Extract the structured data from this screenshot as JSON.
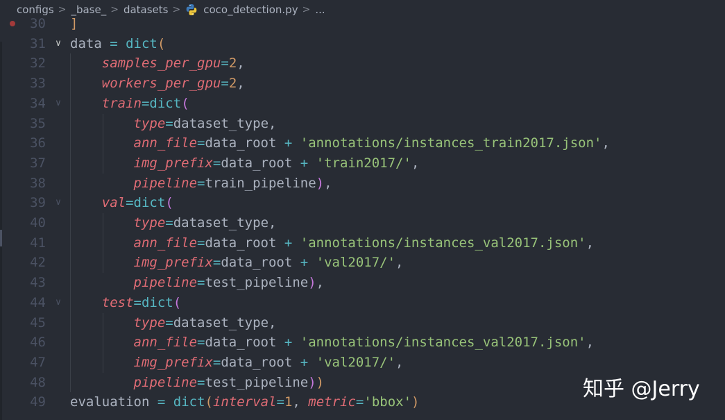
{
  "breadcrumb": {
    "items": [
      "configs",
      "_base_",
      "datasets",
      "coco_detection.py",
      "..."
    ],
    "separator": ">",
    "file_icon": "python-icon"
  },
  "editor": {
    "lines": [
      {
        "num": "30",
        "fold": "",
        "tokens": [
          {
            "t": "]",
            "c": "bracket-close"
          }
        ]
      },
      {
        "num": "31",
        "fold": "v",
        "tokens": [
          {
            "t": "data ",
            "c": "kw-var"
          },
          {
            "t": "=",
            "c": "op"
          },
          {
            "t": " ",
            "c": "kw-var"
          },
          {
            "t": "dict",
            "c": "fn"
          },
          {
            "t": "(",
            "c": "paren2"
          }
        ]
      },
      {
        "num": "32",
        "fold": "",
        "tokens": [
          {
            "t": "    ",
            "c": "kw-var"
          },
          {
            "t": "samples_per_gpu",
            "c": "param"
          },
          {
            "t": "=",
            "c": "op"
          },
          {
            "t": "2",
            "c": "num"
          },
          {
            "t": ",",
            "c": "kw-var"
          }
        ]
      },
      {
        "num": "33",
        "fold": "",
        "tokens": [
          {
            "t": "    ",
            "c": "kw-var"
          },
          {
            "t": "workers_per_gpu",
            "c": "param"
          },
          {
            "t": "=",
            "c": "op"
          },
          {
            "t": "2",
            "c": "num"
          },
          {
            "t": ",",
            "c": "kw-var"
          }
        ]
      },
      {
        "num": "34",
        "fold": "v",
        "tokens": [
          {
            "t": "    ",
            "c": "kw-var"
          },
          {
            "t": "train",
            "c": "param"
          },
          {
            "t": "=",
            "c": "op"
          },
          {
            "t": "dict",
            "c": "fn"
          },
          {
            "t": "(",
            "c": "paren"
          }
        ]
      },
      {
        "num": "35",
        "fold": "",
        "tokens": [
          {
            "t": "        ",
            "c": "kw-var"
          },
          {
            "t": "type",
            "c": "param"
          },
          {
            "t": "=",
            "c": "op"
          },
          {
            "t": "dataset_type,",
            "c": "kw-var"
          }
        ]
      },
      {
        "num": "36",
        "fold": "",
        "tokens": [
          {
            "t": "        ",
            "c": "kw-var"
          },
          {
            "t": "ann_file",
            "c": "param"
          },
          {
            "t": "=",
            "c": "op"
          },
          {
            "t": "data_root ",
            "c": "kw-var"
          },
          {
            "t": "+",
            "c": "op"
          },
          {
            "t": " ",
            "c": "kw-var"
          },
          {
            "t": "'annotations/instances_train2017.json'",
            "c": "str"
          },
          {
            "t": ",",
            "c": "kw-var"
          }
        ]
      },
      {
        "num": "37",
        "fold": "",
        "tokens": [
          {
            "t": "        ",
            "c": "kw-var"
          },
          {
            "t": "img_prefix",
            "c": "param"
          },
          {
            "t": "=",
            "c": "op"
          },
          {
            "t": "data_root ",
            "c": "kw-var"
          },
          {
            "t": "+",
            "c": "op"
          },
          {
            "t": " ",
            "c": "kw-var"
          },
          {
            "t": "'train2017/'",
            "c": "str"
          },
          {
            "t": ",",
            "c": "kw-var"
          }
        ]
      },
      {
        "num": "38",
        "fold": "",
        "tokens": [
          {
            "t": "        ",
            "c": "kw-var"
          },
          {
            "t": "pipeline",
            "c": "param"
          },
          {
            "t": "=",
            "c": "op"
          },
          {
            "t": "train_pipeline",
            "c": "kw-var"
          },
          {
            "t": ")",
            "c": "paren"
          },
          {
            "t": ",",
            "c": "kw-var"
          }
        ]
      },
      {
        "num": "39",
        "fold": "v",
        "tokens": [
          {
            "t": "    ",
            "c": "kw-var"
          },
          {
            "t": "val",
            "c": "param"
          },
          {
            "t": "=",
            "c": "op"
          },
          {
            "t": "dict",
            "c": "fn"
          },
          {
            "t": "(",
            "c": "paren"
          }
        ]
      },
      {
        "num": "40",
        "fold": "",
        "tokens": [
          {
            "t": "        ",
            "c": "kw-var"
          },
          {
            "t": "type",
            "c": "param"
          },
          {
            "t": "=",
            "c": "op"
          },
          {
            "t": "dataset_type,",
            "c": "kw-var"
          }
        ]
      },
      {
        "num": "41",
        "fold": "",
        "tokens": [
          {
            "t": "        ",
            "c": "kw-var"
          },
          {
            "t": "ann_file",
            "c": "param"
          },
          {
            "t": "=",
            "c": "op"
          },
          {
            "t": "data_root ",
            "c": "kw-var"
          },
          {
            "t": "+",
            "c": "op"
          },
          {
            "t": " ",
            "c": "kw-var"
          },
          {
            "t": "'annotations/instances_val2017.json'",
            "c": "str"
          },
          {
            "t": ",",
            "c": "kw-var"
          }
        ]
      },
      {
        "num": "42",
        "fold": "",
        "tokens": [
          {
            "t": "        ",
            "c": "kw-var"
          },
          {
            "t": "img_prefix",
            "c": "param"
          },
          {
            "t": "=",
            "c": "op"
          },
          {
            "t": "data_root ",
            "c": "kw-var"
          },
          {
            "t": "+",
            "c": "op"
          },
          {
            "t": " ",
            "c": "kw-var"
          },
          {
            "t": "'val2017/'",
            "c": "str"
          },
          {
            "t": ",",
            "c": "kw-var"
          }
        ]
      },
      {
        "num": "43",
        "fold": "",
        "tokens": [
          {
            "t": "        ",
            "c": "kw-var"
          },
          {
            "t": "pipeline",
            "c": "param"
          },
          {
            "t": "=",
            "c": "op"
          },
          {
            "t": "test_pipeline",
            "c": "kw-var"
          },
          {
            "t": ")",
            "c": "paren"
          },
          {
            "t": ",",
            "c": "kw-var"
          }
        ]
      },
      {
        "num": "44",
        "fold": "v",
        "tokens": [
          {
            "t": "    ",
            "c": "kw-var"
          },
          {
            "t": "test",
            "c": "param"
          },
          {
            "t": "=",
            "c": "op"
          },
          {
            "t": "dict",
            "c": "fn"
          },
          {
            "t": "(",
            "c": "paren"
          }
        ]
      },
      {
        "num": "45",
        "fold": "",
        "tokens": [
          {
            "t": "        ",
            "c": "kw-var"
          },
          {
            "t": "type",
            "c": "param"
          },
          {
            "t": "=",
            "c": "op"
          },
          {
            "t": "dataset_type,",
            "c": "kw-var"
          }
        ]
      },
      {
        "num": "46",
        "fold": "",
        "tokens": [
          {
            "t": "        ",
            "c": "kw-var"
          },
          {
            "t": "ann_file",
            "c": "param"
          },
          {
            "t": "=",
            "c": "op"
          },
          {
            "t": "data_root ",
            "c": "kw-var"
          },
          {
            "t": "+",
            "c": "op"
          },
          {
            "t": " ",
            "c": "kw-var"
          },
          {
            "t": "'annotations/instances_val2017.json'",
            "c": "str"
          },
          {
            "t": ",",
            "c": "kw-var"
          }
        ]
      },
      {
        "num": "47",
        "fold": "",
        "tokens": [
          {
            "t": "        ",
            "c": "kw-var"
          },
          {
            "t": "img_prefix",
            "c": "param"
          },
          {
            "t": "=",
            "c": "op"
          },
          {
            "t": "data_root ",
            "c": "kw-var"
          },
          {
            "t": "+",
            "c": "op"
          },
          {
            "t": " ",
            "c": "kw-var"
          },
          {
            "t": "'val2017/'",
            "c": "str"
          },
          {
            "t": ",",
            "c": "kw-var"
          }
        ]
      },
      {
        "num": "48",
        "fold": "",
        "tokens": [
          {
            "t": "        ",
            "c": "kw-var"
          },
          {
            "t": "pipeline",
            "c": "param"
          },
          {
            "t": "=",
            "c": "op"
          },
          {
            "t": "test_pipeline",
            "c": "kw-var"
          },
          {
            "t": ")",
            "c": "paren"
          },
          {
            "t": ")",
            "c": "paren2"
          }
        ]
      },
      {
        "num": "49",
        "fold": "",
        "tokens": [
          {
            "t": "evaluation ",
            "c": "kw-var"
          },
          {
            "t": "=",
            "c": "op"
          },
          {
            "t": " ",
            "c": "kw-var"
          },
          {
            "t": "dict",
            "c": "fn"
          },
          {
            "t": "(",
            "c": "paren2"
          },
          {
            "t": "interval",
            "c": "param"
          },
          {
            "t": "=",
            "c": "op"
          },
          {
            "t": "1",
            "c": "num"
          },
          {
            "t": ", ",
            "c": "kw-var"
          },
          {
            "t": "metric",
            "c": "param"
          },
          {
            "t": "=",
            "c": "op"
          },
          {
            "t": "'bbox'",
            "c": "str"
          },
          {
            "t": ")",
            "c": "paren2"
          }
        ]
      }
    ]
  },
  "watermark": {
    "text": "知乎 @Jerry"
  },
  "colors": {
    "background": "#282c34",
    "param": "#e06c75",
    "function": "#56b6c2",
    "string": "#98c379",
    "number": "#d19a66",
    "paren": "#c678dd",
    "line_number": "#4b5263"
  }
}
